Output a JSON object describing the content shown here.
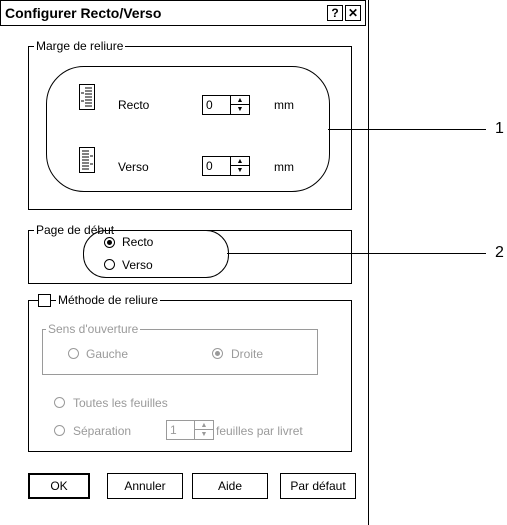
{
  "window": {
    "title": "Configurer Recto/Verso",
    "help_btn": "?",
    "close_btn": "✕"
  },
  "binding_margin": {
    "legend": "Marge de reliure",
    "recto_label": "Recto",
    "recto_value": "0",
    "verso_label": "Verso",
    "verso_value": "0",
    "unit": "mm"
  },
  "start_page": {
    "legend": "Page de début",
    "recto_label": "Recto",
    "verso_label": "Verso",
    "selected": "Recto"
  },
  "binding_method": {
    "checkbox_label": "Méthode de reliure",
    "checked": false,
    "opening": {
      "legend": "Sens d'ouverture",
      "left_label": "Gauche",
      "right_label": "Droite",
      "selected": "Droite"
    },
    "all_sheets_label": "Toutes les feuilles",
    "separation_label": "Séparation",
    "separation_value": "1",
    "separation_suffix": "feuilles par livret"
  },
  "buttons": {
    "ok": "OK",
    "cancel": "Annuler",
    "help": "Aide",
    "default": "Par défaut"
  },
  "callouts": {
    "one": "1",
    "two": "2"
  }
}
